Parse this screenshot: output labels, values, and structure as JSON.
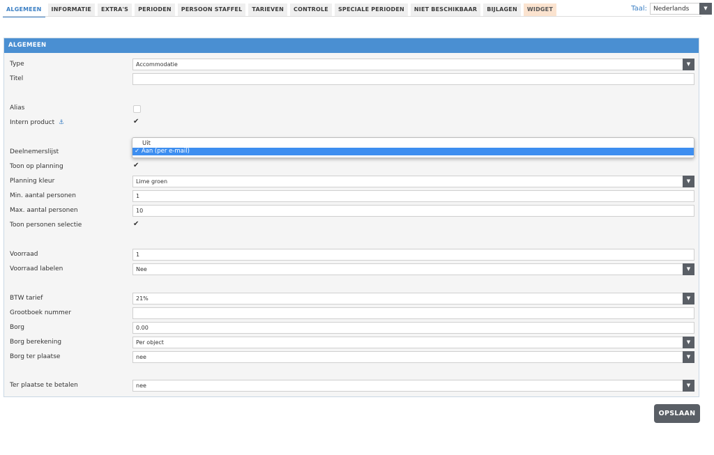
{
  "tabs": [
    {
      "label": "ALGEMEEN",
      "state": "active"
    },
    {
      "label": "INFORMATIE"
    },
    {
      "label": "EXTRA'S"
    },
    {
      "label": "PERIODEN"
    },
    {
      "label": "PERSOON STAFFEL"
    },
    {
      "label": "TARIEVEN"
    },
    {
      "label": "CONTROLE"
    },
    {
      "label": "SPECIALE PERIODEN"
    },
    {
      "label": "NIET BESCHIKBAAR"
    },
    {
      "label": "BIJLAGEN"
    },
    {
      "label": "WIDGET",
      "highlight": "#fbe3cf"
    }
  ],
  "language": {
    "label": "Taal:",
    "value": "Nederlands"
  },
  "panel": {
    "title": "ALGEMEEN"
  },
  "form": {
    "type": {
      "label": "Type",
      "value": "Accommodatie"
    },
    "titel": {
      "label": "Titel",
      "value": ""
    },
    "alias": {
      "label": "Alias",
      "checked": false
    },
    "intern_product": {
      "label": "Intern product",
      "checked": true
    },
    "deelnemerslijst": {
      "label": "Deelnemerslijst",
      "options": [
        "Uit",
        "Aan (per e-mail)"
      ],
      "selected": "Aan (per e-mail)"
    },
    "toon_op_planning": {
      "label": "Toon op planning",
      "checked": true
    },
    "planning_kleur": {
      "label": "Planning kleur",
      "value": "Lime groen"
    },
    "min_personen": {
      "label": "Min. aantal personen",
      "value": "1"
    },
    "max_personen": {
      "label": "Max. aantal personen",
      "value": "10"
    },
    "toon_personen_selectie": {
      "label": "Toon personen selectie",
      "checked": true
    },
    "voorraad": {
      "label": "Voorraad",
      "value": "1"
    },
    "voorraad_labelen": {
      "label": "Voorraad labelen",
      "value": "Nee"
    },
    "btw_tarief": {
      "label": "BTW tarief",
      "value": "21%"
    },
    "grootboek_nummer": {
      "label": "Grootboek nummer",
      "value": ""
    },
    "borg": {
      "label": "Borg",
      "value": "0.00"
    },
    "borg_berekening": {
      "label": "Borg berekening",
      "value": "Per object"
    },
    "borg_ter_plaatse": {
      "label": "Borg ter plaatse",
      "value": "nee"
    },
    "ter_plaatse_te_betalen": {
      "label": "Ter plaatse te betalen",
      "value": "nee"
    }
  },
  "dropdown": {
    "option_1": "Uit",
    "option_2": "✓ Aan (per e-mail)"
  },
  "save_label": "OPSLAAN",
  "colors": {
    "accent": "#4a8fd2",
    "button": "#5a5f66",
    "selected_option": "#3d8ef0"
  },
  "icons": {
    "check": "✔",
    "arrow": "chevron-down-icon",
    "info": "info-icon"
  }
}
